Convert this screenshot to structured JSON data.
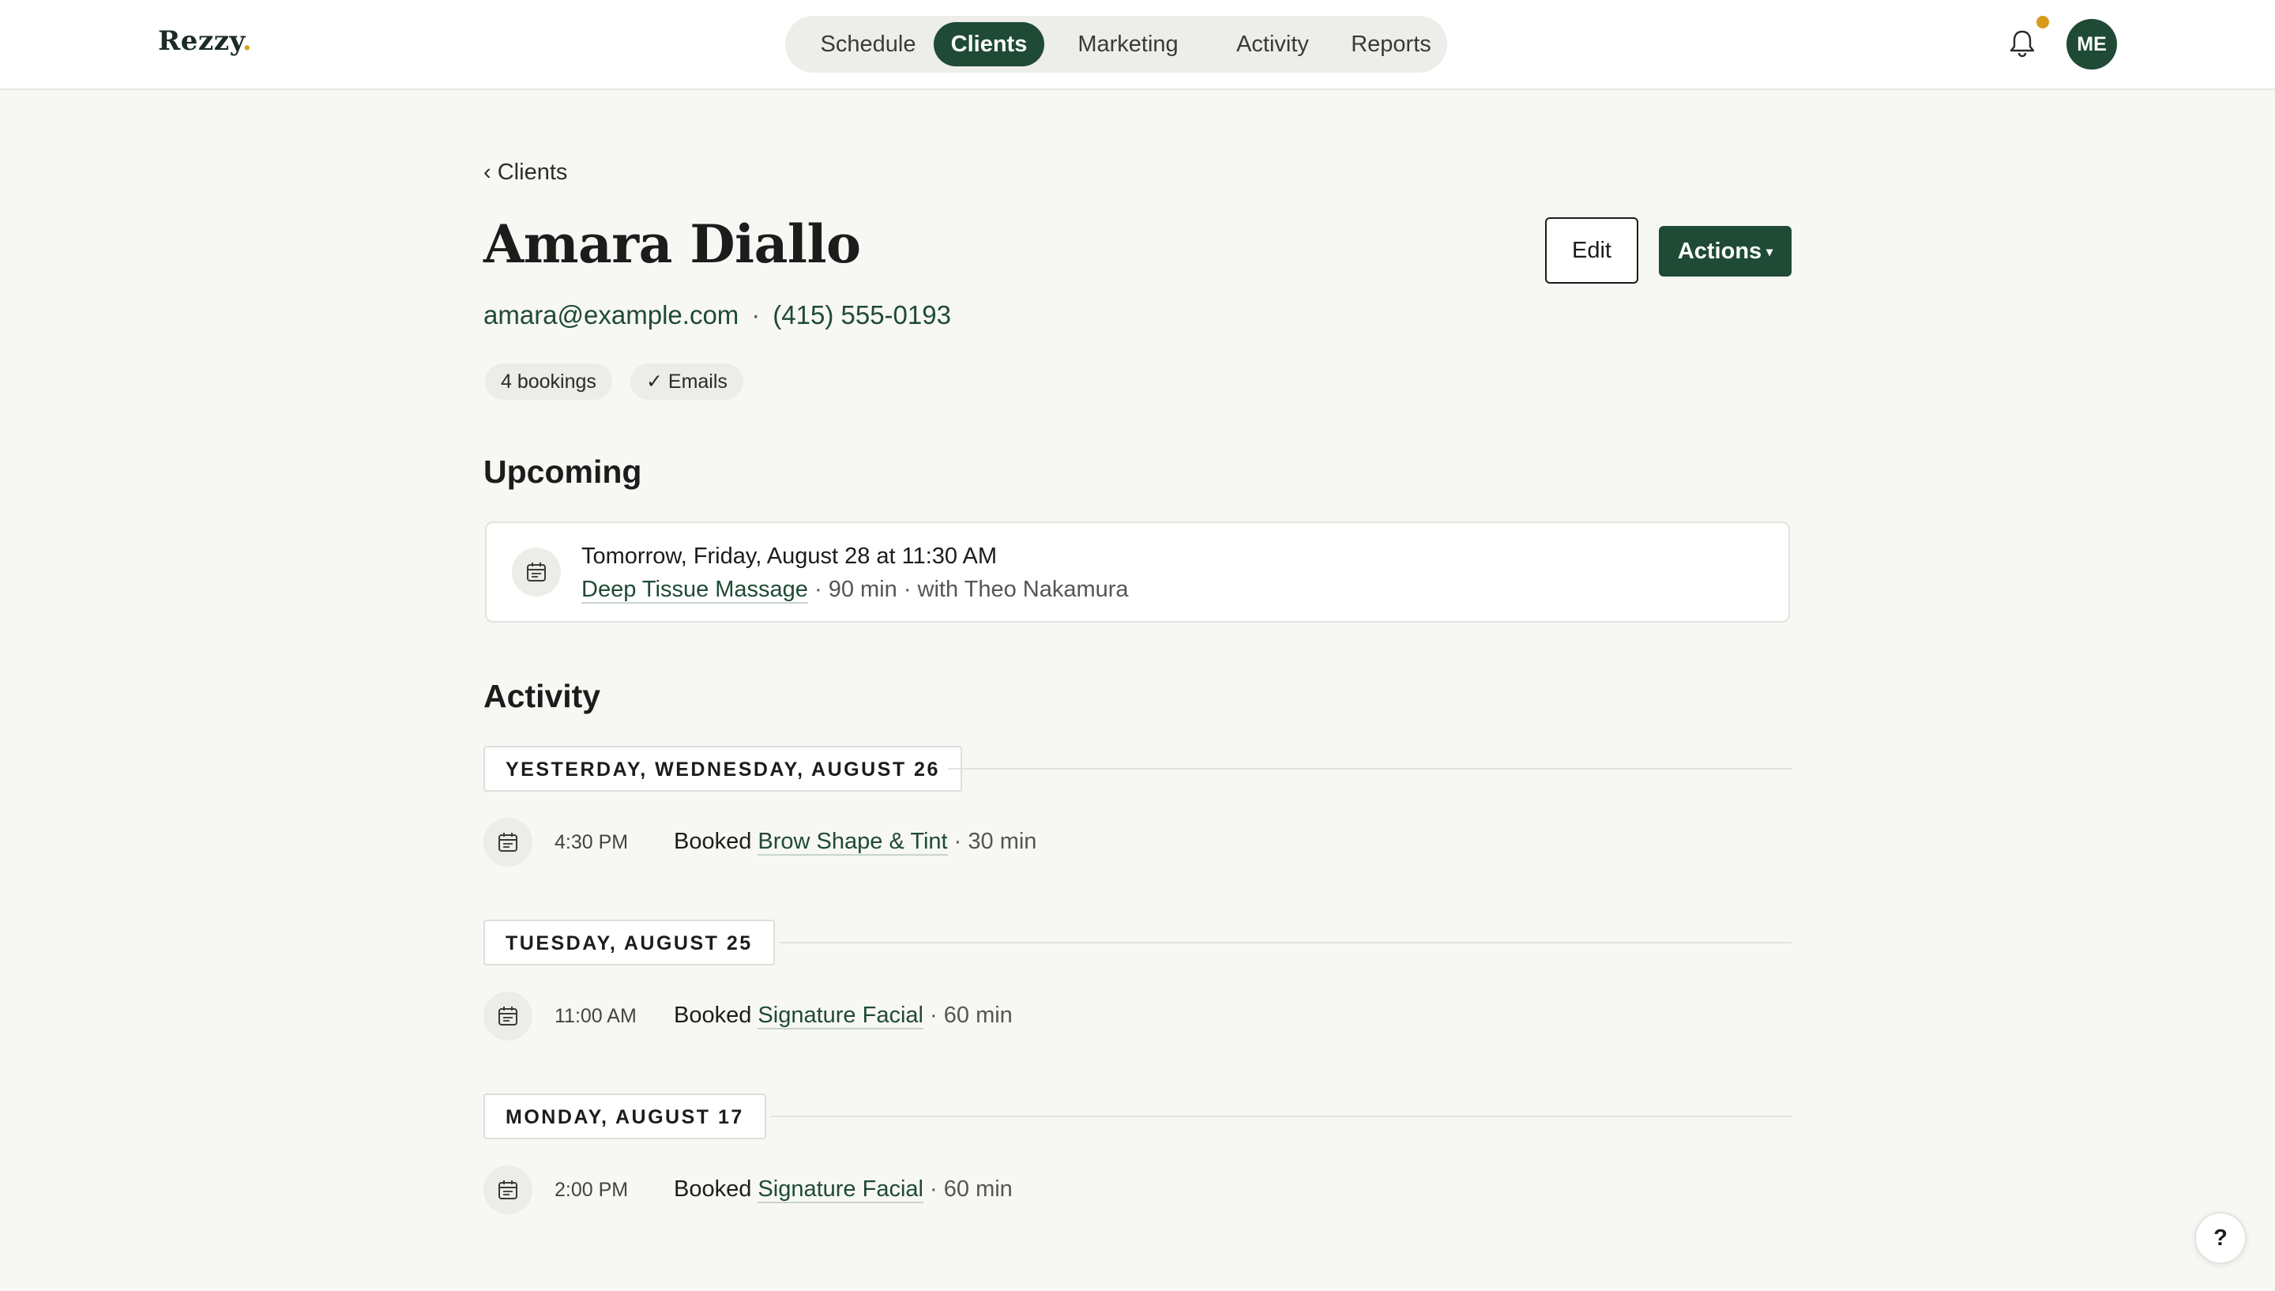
{
  "app": {
    "logo_text": "Rezzy",
    "logo_dot": ".",
    "accent_color": "#1f4a36",
    "notification_dot_color": "#d99a1b"
  },
  "nav": {
    "items": [
      {
        "label": "Schedule",
        "active": false
      },
      {
        "label": "Clients",
        "active": true
      },
      {
        "label": "Marketing",
        "active": false
      },
      {
        "label": "Activity",
        "active": false
      },
      {
        "label": "Reports",
        "active": false
      }
    ],
    "bell_icon": "bell-icon",
    "avatar_initials": "ME"
  },
  "breadcrumb": {
    "chevron": "‹",
    "label": "Clients"
  },
  "client": {
    "name": "Amara Diallo",
    "email": "amara@example.com",
    "separator": "·",
    "phone": "(415) 555-0193",
    "chips": [
      "4 bookings",
      "✓ Emails"
    ]
  },
  "buttons": {
    "edit_label": "Edit",
    "actions_label": "Actions",
    "actions_caret": "▾"
  },
  "upcoming": {
    "title": "Upcoming",
    "when": "Tomorrow, Friday, August 28 at 11:30 AM",
    "service": "Deep Tissue Massage",
    "details": "· 90 min · with Theo Nakamura",
    "icon": "calendar-icon"
  },
  "activity": {
    "title": "Activity",
    "groups": [
      {
        "date": "YESTERDAY, WEDNESDAY, AUGUST 26",
        "entries": [
          {
            "time": "4:30 PM",
            "verb": "Booked",
            "service": "Brow Shape & Tint",
            "meta": "· 30 min"
          }
        ]
      },
      {
        "date": "TUESDAY, AUGUST 25",
        "entries": [
          {
            "time": "11:00 AM",
            "verb": "Booked",
            "service": "Signature Facial",
            "meta": "· 60 min"
          }
        ]
      },
      {
        "date": "MONDAY, AUGUST 17",
        "entries": [
          {
            "time": "2:00 PM",
            "verb": "Booked",
            "service": "Signature Facial",
            "meta": "· 60 min"
          }
        ]
      }
    ]
  },
  "help": {
    "label": "?"
  }
}
